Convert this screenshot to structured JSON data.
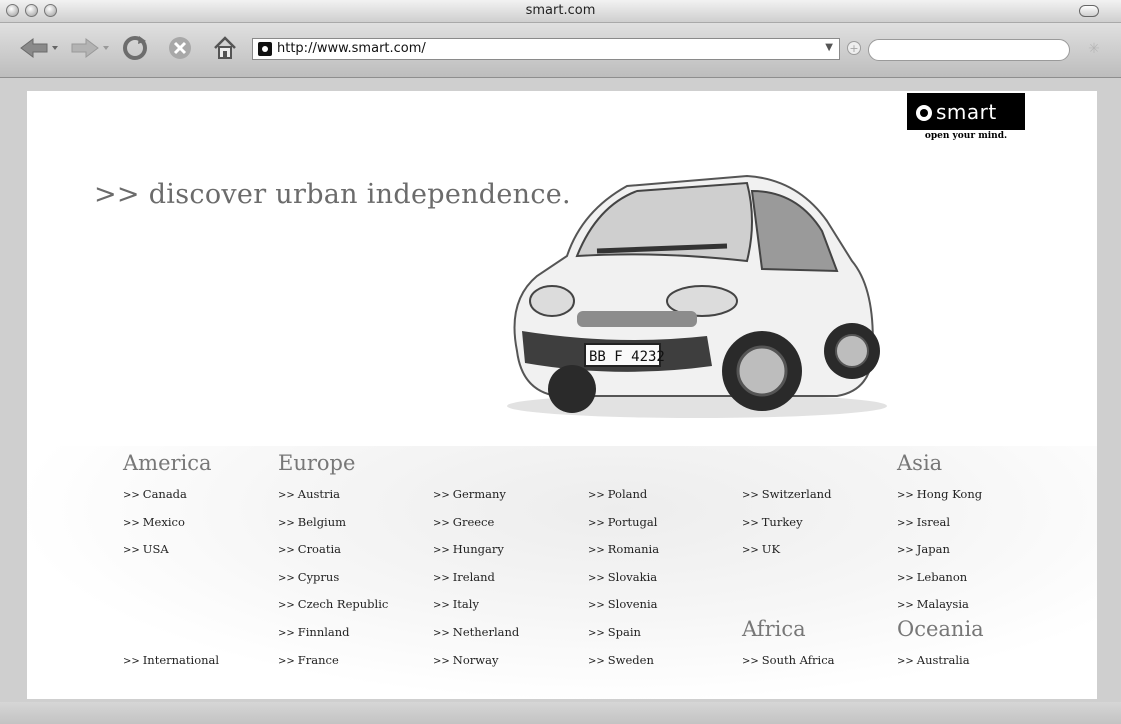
{
  "window": {
    "title": "smart.com"
  },
  "toolbar": {
    "url": "http://www.smart.com/",
    "url_dropdown_icon": "triangle-down",
    "search_placeholder": ""
  },
  "page": {
    "logo_text": "smart",
    "tagline": "open your mind.",
    "headline": ">> discover urban independence.",
    "car_plate": "BB F 4232"
  },
  "regions": {
    "america": {
      "title": "America",
      "links": [
        "Canada",
        "Mexico",
        "USA"
      ],
      "international": "International"
    },
    "europe": {
      "title": "Europe",
      "col1": [
        "Austria",
        "Belgium",
        "Croatia",
        "Cyprus",
        "Czech Republic",
        "Finnland",
        "France"
      ],
      "col2": [
        "Germany",
        "Greece",
        "Hungary",
        "Ireland",
        "Italy",
        "Netherland",
        "Norway"
      ],
      "col3": [
        "Poland",
        "Portugal",
        "Romania",
        "Slovakia",
        "Slovenia",
        "Spain",
        "Sweden"
      ],
      "col4": [
        "Switzerland",
        "Turkey",
        "UK"
      ]
    },
    "africa": {
      "title": "Africa",
      "links": [
        "South Africa"
      ]
    },
    "asia": {
      "title": "Asia",
      "links": [
        "Hong Kong",
        "Isreal",
        "Japan",
        "Lebanon",
        "Malaysia"
      ]
    },
    "oceania": {
      "title": "Oceania",
      "links": [
        "Australia"
      ]
    }
  },
  "link_prefix": ">>"
}
